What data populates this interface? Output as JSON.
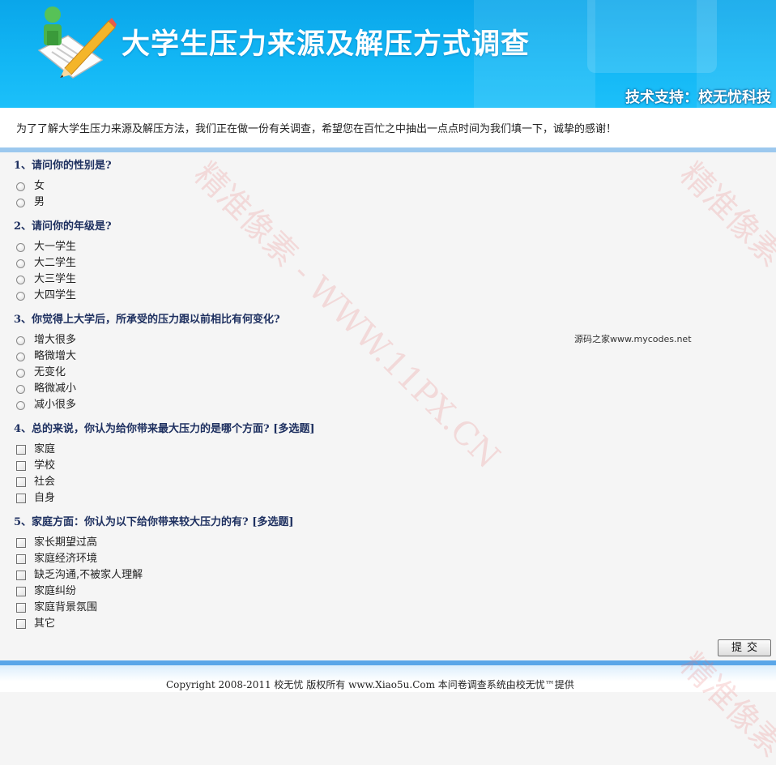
{
  "header": {
    "title": "大学生压力来源及解压方式调查",
    "support": "技术支持：校无忧科技"
  },
  "intro": "为了了解大学生压力来源及解压方法，我们正在做一份有关调查，希望您在百忙之中抽出一点点时间为我们填一下，诚挚的感谢！",
  "questions": [
    {
      "title": "1、请问你的性别是?",
      "type": "radio",
      "options": [
        "女",
        "男"
      ]
    },
    {
      "title": "2、请问你的年级是?",
      "type": "radio",
      "options": [
        "大一学生",
        "大二学生",
        "大三学生",
        "大四学生"
      ]
    },
    {
      "title": "3、你觉得上大学后，所承受的压力跟以前相比有何变化?",
      "type": "radio",
      "options": [
        "增大很多",
        "略微增大",
        "无变化",
        "略微减小",
        "减小很多"
      ]
    },
    {
      "title": "4、总的来说，你认为给你带来最大压力的是哪个方面? [多选题]",
      "type": "checkbox",
      "options": [
        "家庭",
        "学校",
        "社会",
        "自身"
      ]
    },
    {
      "title": "5、家庭方面：你认为以下给你带来较大压力的有? [多选题]",
      "type": "checkbox",
      "options": [
        "家长期望过高",
        "家庭经济环境",
        "缺乏沟通,不被家人理解",
        "家庭纠纷",
        "家庭背景氛围",
        "其它"
      ]
    }
  ],
  "side_note": "源码之家www.mycodes.net",
  "submit_label": "提交",
  "footer": "Copyright 2008-2011 校无忧 版权所有 www.Xiao5u.Com 本问卷调查系统由校无忧™提供",
  "watermarks": [
    "精准像素 - WWW.11PX.CN",
    "精准像素",
    "精准像素"
  ]
}
